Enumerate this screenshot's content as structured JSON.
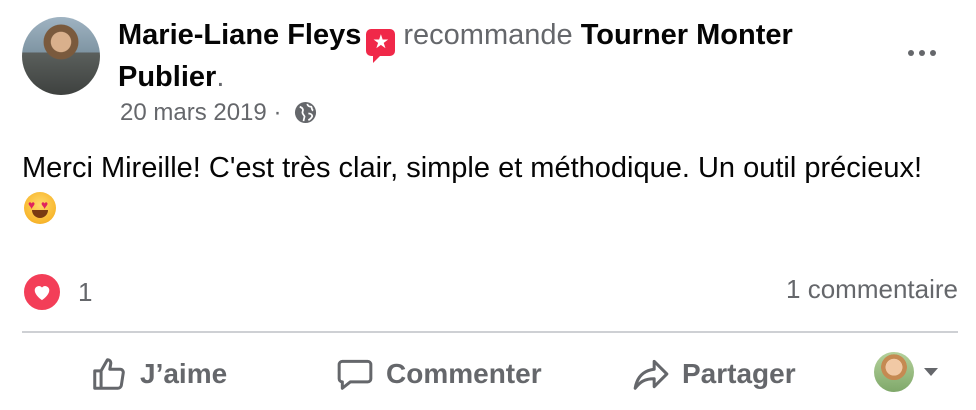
{
  "post": {
    "author_name": "Marie-Liane Fleys",
    "recommend_word": "recommande",
    "page_name": "Tourner Monter Publier",
    "punctuation": ".",
    "date": "20 mars 2019",
    "separator": "·",
    "body": "Merci Mireille! C'est très clair, simple et méthodique. Un outil précieux!",
    "reaction_count": "1",
    "comments": "1 commentaire"
  },
  "actions": {
    "like": "J’aime",
    "comment": "Commenter",
    "share": "Partager"
  },
  "icons": {
    "recommend": "recommend-star-icon",
    "privacy": "globe-icon",
    "more": "more-dots-icon",
    "reaction": "heart-reaction-icon",
    "emoji": "heart-eyes-emoji-icon",
    "like": "thumbs-up-icon",
    "comment": "comment-bubble-icon",
    "share": "share-arrow-icon"
  },
  "colors": {
    "secondary_text": "#65676b",
    "reaction_heart": "#f33e58",
    "recommend_badge": "#f02849"
  }
}
